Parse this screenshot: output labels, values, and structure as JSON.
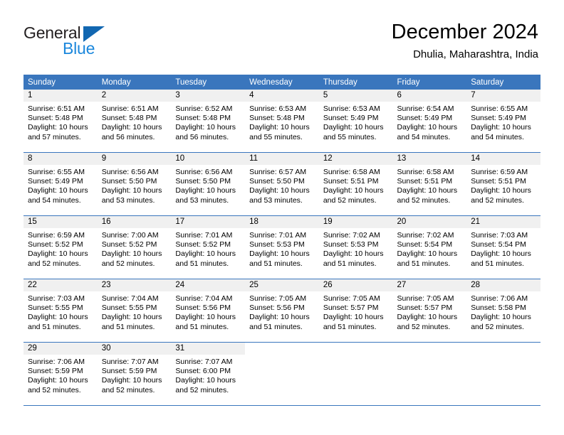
{
  "brand": {
    "name_top": "General",
    "name_bottom": "Blue",
    "accent_color": "#1b87dc",
    "triangle_color": "#1267b1"
  },
  "header": {
    "title": "December 2024",
    "subtitle": "Dhulia, Maharashtra, India"
  },
  "theme": {
    "header_row_bg": "#3a76bd",
    "header_row_text": "#ffffff",
    "daynum_bg": "#f0f0f0",
    "rule_color": "#3a76bd"
  },
  "weekday_headers": [
    "Sunday",
    "Monday",
    "Tuesday",
    "Wednesday",
    "Thursday",
    "Friday",
    "Saturday"
  ],
  "labels": {
    "sunrise_prefix": "Sunrise:",
    "sunset_prefix": "Sunset:",
    "daylight_prefix": "Daylight:"
  },
  "weeks": [
    [
      {
        "day": "1",
        "sunrise": "Sunrise: 6:51 AM",
        "sunset": "Sunset: 5:48 PM",
        "daylight_line1": "Daylight: 10 hours",
        "daylight_line2": "and 57 minutes."
      },
      {
        "day": "2",
        "sunrise": "Sunrise: 6:51 AM",
        "sunset": "Sunset: 5:48 PM",
        "daylight_line1": "Daylight: 10 hours",
        "daylight_line2": "and 56 minutes."
      },
      {
        "day": "3",
        "sunrise": "Sunrise: 6:52 AM",
        "sunset": "Sunset: 5:48 PM",
        "daylight_line1": "Daylight: 10 hours",
        "daylight_line2": "and 56 minutes."
      },
      {
        "day": "4",
        "sunrise": "Sunrise: 6:53 AM",
        "sunset": "Sunset: 5:48 PM",
        "daylight_line1": "Daylight: 10 hours",
        "daylight_line2": "and 55 minutes."
      },
      {
        "day": "5",
        "sunrise": "Sunrise: 6:53 AM",
        "sunset": "Sunset: 5:49 PM",
        "daylight_line1": "Daylight: 10 hours",
        "daylight_line2": "and 55 minutes."
      },
      {
        "day": "6",
        "sunrise": "Sunrise: 6:54 AM",
        "sunset": "Sunset: 5:49 PM",
        "daylight_line1": "Daylight: 10 hours",
        "daylight_line2": "and 54 minutes."
      },
      {
        "day": "7",
        "sunrise": "Sunrise: 6:55 AM",
        "sunset": "Sunset: 5:49 PM",
        "daylight_line1": "Daylight: 10 hours",
        "daylight_line2": "and 54 minutes."
      }
    ],
    [
      {
        "day": "8",
        "sunrise": "Sunrise: 6:55 AM",
        "sunset": "Sunset: 5:49 PM",
        "daylight_line1": "Daylight: 10 hours",
        "daylight_line2": "and 54 minutes."
      },
      {
        "day": "9",
        "sunrise": "Sunrise: 6:56 AM",
        "sunset": "Sunset: 5:50 PM",
        "daylight_line1": "Daylight: 10 hours",
        "daylight_line2": "and 53 minutes."
      },
      {
        "day": "10",
        "sunrise": "Sunrise: 6:56 AM",
        "sunset": "Sunset: 5:50 PM",
        "daylight_line1": "Daylight: 10 hours",
        "daylight_line2": "and 53 minutes."
      },
      {
        "day": "11",
        "sunrise": "Sunrise: 6:57 AM",
        "sunset": "Sunset: 5:50 PM",
        "daylight_line1": "Daylight: 10 hours",
        "daylight_line2": "and 53 minutes."
      },
      {
        "day": "12",
        "sunrise": "Sunrise: 6:58 AM",
        "sunset": "Sunset: 5:51 PM",
        "daylight_line1": "Daylight: 10 hours",
        "daylight_line2": "and 52 minutes."
      },
      {
        "day": "13",
        "sunrise": "Sunrise: 6:58 AM",
        "sunset": "Sunset: 5:51 PM",
        "daylight_line1": "Daylight: 10 hours",
        "daylight_line2": "and 52 minutes."
      },
      {
        "day": "14",
        "sunrise": "Sunrise: 6:59 AM",
        "sunset": "Sunset: 5:51 PM",
        "daylight_line1": "Daylight: 10 hours",
        "daylight_line2": "and 52 minutes."
      }
    ],
    [
      {
        "day": "15",
        "sunrise": "Sunrise: 6:59 AM",
        "sunset": "Sunset: 5:52 PM",
        "daylight_line1": "Daylight: 10 hours",
        "daylight_line2": "and 52 minutes."
      },
      {
        "day": "16",
        "sunrise": "Sunrise: 7:00 AM",
        "sunset": "Sunset: 5:52 PM",
        "daylight_line1": "Daylight: 10 hours",
        "daylight_line2": "and 52 minutes."
      },
      {
        "day": "17",
        "sunrise": "Sunrise: 7:01 AM",
        "sunset": "Sunset: 5:52 PM",
        "daylight_line1": "Daylight: 10 hours",
        "daylight_line2": "and 51 minutes."
      },
      {
        "day": "18",
        "sunrise": "Sunrise: 7:01 AM",
        "sunset": "Sunset: 5:53 PM",
        "daylight_line1": "Daylight: 10 hours",
        "daylight_line2": "and 51 minutes."
      },
      {
        "day": "19",
        "sunrise": "Sunrise: 7:02 AM",
        "sunset": "Sunset: 5:53 PM",
        "daylight_line1": "Daylight: 10 hours",
        "daylight_line2": "and 51 minutes."
      },
      {
        "day": "20",
        "sunrise": "Sunrise: 7:02 AM",
        "sunset": "Sunset: 5:54 PM",
        "daylight_line1": "Daylight: 10 hours",
        "daylight_line2": "and 51 minutes."
      },
      {
        "day": "21",
        "sunrise": "Sunrise: 7:03 AM",
        "sunset": "Sunset: 5:54 PM",
        "daylight_line1": "Daylight: 10 hours",
        "daylight_line2": "and 51 minutes."
      }
    ],
    [
      {
        "day": "22",
        "sunrise": "Sunrise: 7:03 AM",
        "sunset": "Sunset: 5:55 PM",
        "daylight_line1": "Daylight: 10 hours",
        "daylight_line2": "and 51 minutes."
      },
      {
        "day": "23",
        "sunrise": "Sunrise: 7:04 AM",
        "sunset": "Sunset: 5:55 PM",
        "daylight_line1": "Daylight: 10 hours",
        "daylight_line2": "and 51 minutes."
      },
      {
        "day": "24",
        "sunrise": "Sunrise: 7:04 AM",
        "sunset": "Sunset: 5:56 PM",
        "daylight_line1": "Daylight: 10 hours",
        "daylight_line2": "and 51 minutes."
      },
      {
        "day": "25",
        "sunrise": "Sunrise: 7:05 AM",
        "sunset": "Sunset: 5:56 PM",
        "daylight_line1": "Daylight: 10 hours",
        "daylight_line2": "and 51 minutes."
      },
      {
        "day": "26",
        "sunrise": "Sunrise: 7:05 AM",
        "sunset": "Sunset: 5:57 PM",
        "daylight_line1": "Daylight: 10 hours",
        "daylight_line2": "and 51 minutes."
      },
      {
        "day": "27",
        "sunrise": "Sunrise: 7:05 AM",
        "sunset": "Sunset: 5:57 PM",
        "daylight_line1": "Daylight: 10 hours",
        "daylight_line2": "and 52 minutes."
      },
      {
        "day": "28",
        "sunrise": "Sunrise: 7:06 AM",
        "sunset": "Sunset: 5:58 PM",
        "daylight_line1": "Daylight: 10 hours",
        "daylight_line2": "and 52 minutes."
      }
    ],
    [
      {
        "day": "29",
        "sunrise": "Sunrise: 7:06 AM",
        "sunset": "Sunset: 5:59 PM",
        "daylight_line1": "Daylight: 10 hours",
        "daylight_line2": "and 52 minutes."
      },
      {
        "day": "30",
        "sunrise": "Sunrise: 7:07 AM",
        "sunset": "Sunset: 5:59 PM",
        "daylight_line1": "Daylight: 10 hours",
        "daylight_line2": "and 52 minutes."
      },
      {
        "day": "31",
        "sunrise": "Sunrise: 7:07 AM",
        "sunset": "Sunset: 6:00 PM",
        "daylight_line1": "Daylight: 10 hours",
        "daylight_line2": "and 52 minutes."
      },
      {
        "day": "",
        "sunrise": "",
        "sunset": "",
        "daylight_line1": "",
        "daylight_line2": ""
      },
      {
        "day": "",
        "sunrise": "",
        "sunset": "",
        "daylight_line1": "",
        "daylight_line2": ""
      },
      {
        "day": "",
        "sunrise": "",
        "sunset": "",
        "daylight_line1": "",
        "daylight_line2": ""
      },
      {
        "day": "",
        "sunrise": "",
        "sunset": "",
        "daylight_line1": "",
        "daylight_line2": ""
      }
    ]
  ]
}
